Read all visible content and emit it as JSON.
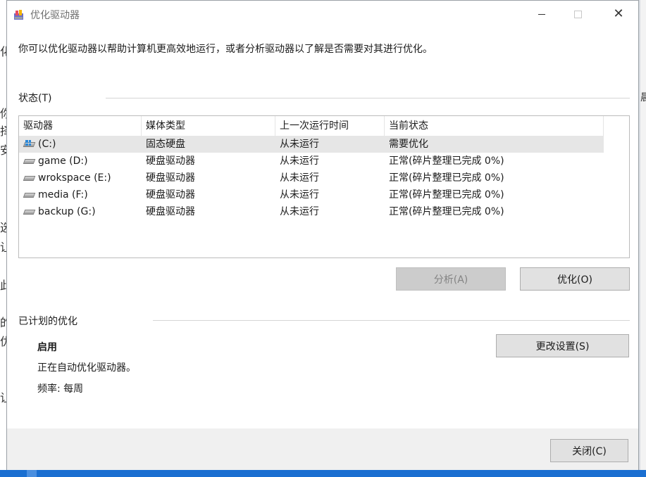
{
  "background": {
    "left_fragments": [
      "化",
      "你",
      "择",
      "安",
      "选",
      "让",
      "此",
      "的",
      "优",
      "让"
    ],
    "right_fragment": "晨"
  },
  "window": {
    "title": "优化驱动器",
    "icons": {
      "app": "defrag-app-icon",
      "minimize": "minimize-icon",
      "maximize": "maximize-icon",
      "close": "close-icon"
    },
    "close_glyph": "✕",
    "intro": "你可以优化驱动器以帮助计算机更高效地运行，或者分析驱动器以了解是否需要对其进行优化。"
  },
  "status": {
    "label": "状态(T)",
    "columns": [
      "驱动器",
      "媒体类型",
      "上一次运行时间",
      "当前状态"
    ],
    "drives": [
      {
        "name": "(C:)",
        "icon": "system-drive-icon",
        "media": "固态硬盘",
        "last_run": "从未运行",
        "state": "需要优化",
        "selected": true
      },
      {
        "name": "game (D:)",
        "icon": "hard-drive-icon",
        "media": "硬盘驱动器",
        "last_run": "从未运行",
        "state": "正常(碎片整理已完成 0%)"
      },
      {
        "name": "wrokspace (E:)",
        "icon": "hard-drive-icon",
        "media": "硬盘驱动器",
        "last_run": "从未运行",
        "state": "正常(碎片整理已完成 0%)"
      },
      {
        "name": "media (F:)",
        "icon": "hard-drive-icon",
        "media": "硬盘驱动器",
        "last_run": "从未运行",
        "state": "正常(碎片整理已完成 0%)"
      },
      {
        "name": "backup (G:)",
        "icon": "hard-drive-icon",
        "media": "硬盘驱动器",
        "last_run": "从未运行",
        "state": "正常(碎片整理已完成 0%)"
      }
    ],
    "analyze_button": "分析(A)",
    "optimize_button": "优化(O)"
  },
  "schedule": {
    "label": "已计划的优化",
    "state": "启用",
    "description": "正在自动优化驱动器。",
    "frequency": "频率: 每周",
    "change_settings_button": "更改设置(S)"
  },
  "footer": {
    "close_button": "关闭(C)"
  },
  "colors": {
    "selected_row": "#e6e6e6",
    "button_bg": "#e1e1e1",
    "disabled_button_bg": "#cccccc",
    "taskbar": "#1a6fd1"
  }
}
